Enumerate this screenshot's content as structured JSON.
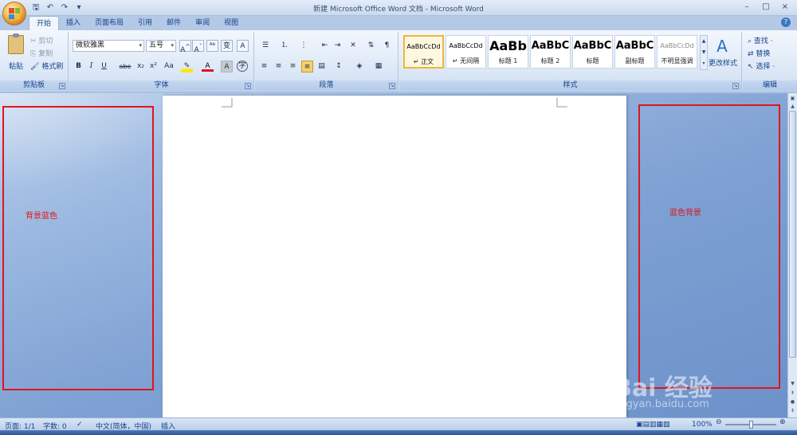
{
  "window": {
    "title": "新建 Microsoft Office Word 文档 - Microsoft Word",
    "controls": [
      "–",
      "□",
      "×"
    ]
  },
  "quick_access": [
    {
      "name": "save-icon",
      "glyph": "🖫"
    },
    {
      "name": "undo-icon",
      "glyph": "↶"
    },
    {
      "name": "redo-icon",
      "glyph": "↷"
    },
    {
      "name": "customize-icon",
      "glyph": "▾"
    }
  ],
  "tabs": [
    "开始",
    "插入",
    "页面布局",
    "引用",
    "邮件",
    "审阅",
    "视图"
  ],
  "active_tab": "开始",
  "ribbon": {
    "clipboard": {
      "label": "剪贴板",
      "paste": "粘贴",
      "cut": "剪切",
      "copy": "复制",
      "format_painter": "格式刷"
    },
    "font": {
      "label": "字体",
      "font_name": "微软雅黑",
      "font_size": "五号",
      "buttons_row2": [
        "B",
        "I",
        "U",
        "abe",
        "x₂",
        "x²",
        "Aa"
      ]
    },
    "paragraph": {
      "label": "段落"
    },
    "styles": {
      "label": "样式",
      "items": [
        {
          "preview": "AaBbCcDd",
          "name": "↵ 正文",
          "selected": true,
          "big": false
        },
        {
          "preview": "AaBbCcDd",
          "name": "↵ 无间隔",
          "selected": false,
          "big": false
        },
        {
          "preview": "AaBb",
          "name": "标题 1",
          "selected": false,
          "big": true
        },
        {
          "preview": "AaBbC",
          "name": "标题 2",
          "selected": false,
          "big": true
        },
        {
          "preview": "AaBbC",
          "name": "标题",
          "selected": false,
          "big": true
        },
        {
          "preview": "AaBbC",
          "name": "副标题",
          "selected": false,
          "big": true
        },
        {
          "preview": "AaBbCcDd",
          "name": "不明显强调",
          "selected": false,
          "big": false
        }
      ],
      "change_styles": "更改样式"
    },
    "editing": {
      "label": "编辑",
      "find": "查找 ·",
      "replace": "替换",
      "select": "选择 ·"
    }
  },
  "annotations": {
    "left": "背景蓝色",
    "right": "蓝色背景"
  },
  "status": {
    "page": "页面: 1/1",
    "words": "字数: 0",
    "language": "中文(简体，中国)",
    "mode": "插入",
    "zoom": "100%"
  },
  "watermark": {
    "brand": "Bai 经验",
    "site": "jingyan.baidu.com"
  },
  "colors": {
    "annotation_red": "#e0151d",
    "ribbon_text": "#15428b",
    "workspace_blue": "#7fa1d3"
  }
}
